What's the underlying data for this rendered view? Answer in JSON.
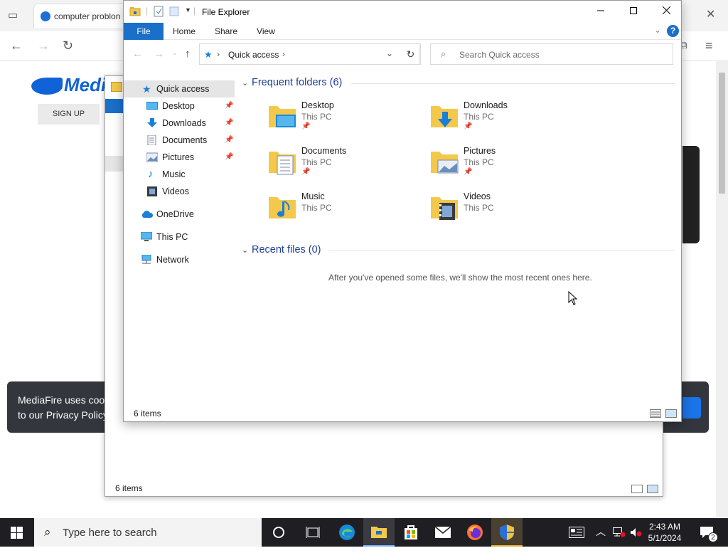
{
  "browser": {
    "tab_title": "computer problon",
    "mediafire": {
      "logo_text": "Medi",
      "signup_label": "SIGN UP",
      "cookie_line1": "MediaFire uses cooki",
      "cookie_line2": "to our Privacy Policy."
    }
  },
  "explorer_back": {
    "status_count": "6 items"
  },
  "explorer": {
    "title": "File Explorer",
    "ribbon_tabs": [
      "File",
      "Home",
      "Share",
      "View"
    ],
    "help_label": "?",
    "address": {
      "location": "Quick access",
      "search_placeholder": "Search Quick access"
    },
    "nav": {
      "quick_access": "Quick access",
      "pinned": [
        {
          "label": "Desktop",
          "icon": "desktop-icon",
          "pinned": true
        },
        {
          "label": "Downloads",
          "icon": "downloads-icon",
          "pinned": true
        },
        {
          "label": "Documents",
          "icon": "documents-icon",
          "pinned": true
        },
        {
          "label": "Pictures",
          "icon": "pictures-icon",
          "pinned": true
        },
        {
          "label": "Music",
          "icon": "music-icon",
          "pinned": false
        },
        {
          "label": "Videos",
          "icon": "videos-icon",
          "pinned": false
        }
      ],
      "onedrive": "OneDrive",
      "this_pc": "This PC",
      "network": "Network"
    },
    "frequent_header": "Frequent folders (6)",
    "recent_header": "Recent files (0)",
    "folders": [
      {
        "name": "Desktop",
        "location": "This PC",
        "pinned": true
      },
      {
        "name": "Downloads",
        "location": "This PC",
        "pinned": true
      },
      {
        "name": "Documents",
        "location": "This PC",
        "pinned": true
      },
      {
        "name": "Pictures",
        "location": "This PC",
        "pinned": true
      },
      {
        "name": "Music",
        "location": "This PC",
        "pinned": false
      },
      {
        "name": "Videos",
        "location": "This PC",
        "pinned": false
      }
    ],
    "recent_empty_message": "After you've opened some files, we'll show the most recent ones here.",
    "status_count": "6 items"
  },
  "taskbar": {
    "search_placeholder": "Type here to search",
    "time": "2:43 AM",
    "date": "5/1/2024",
    "notification_count": "2"
  },
  "colors": {
    "accent": "#1a6fc9",
    "section_header": "#1e3f9a",
    "folder_yellow": "#f3c84b",
    "taskbar": "#1f1f23"
  }
}
